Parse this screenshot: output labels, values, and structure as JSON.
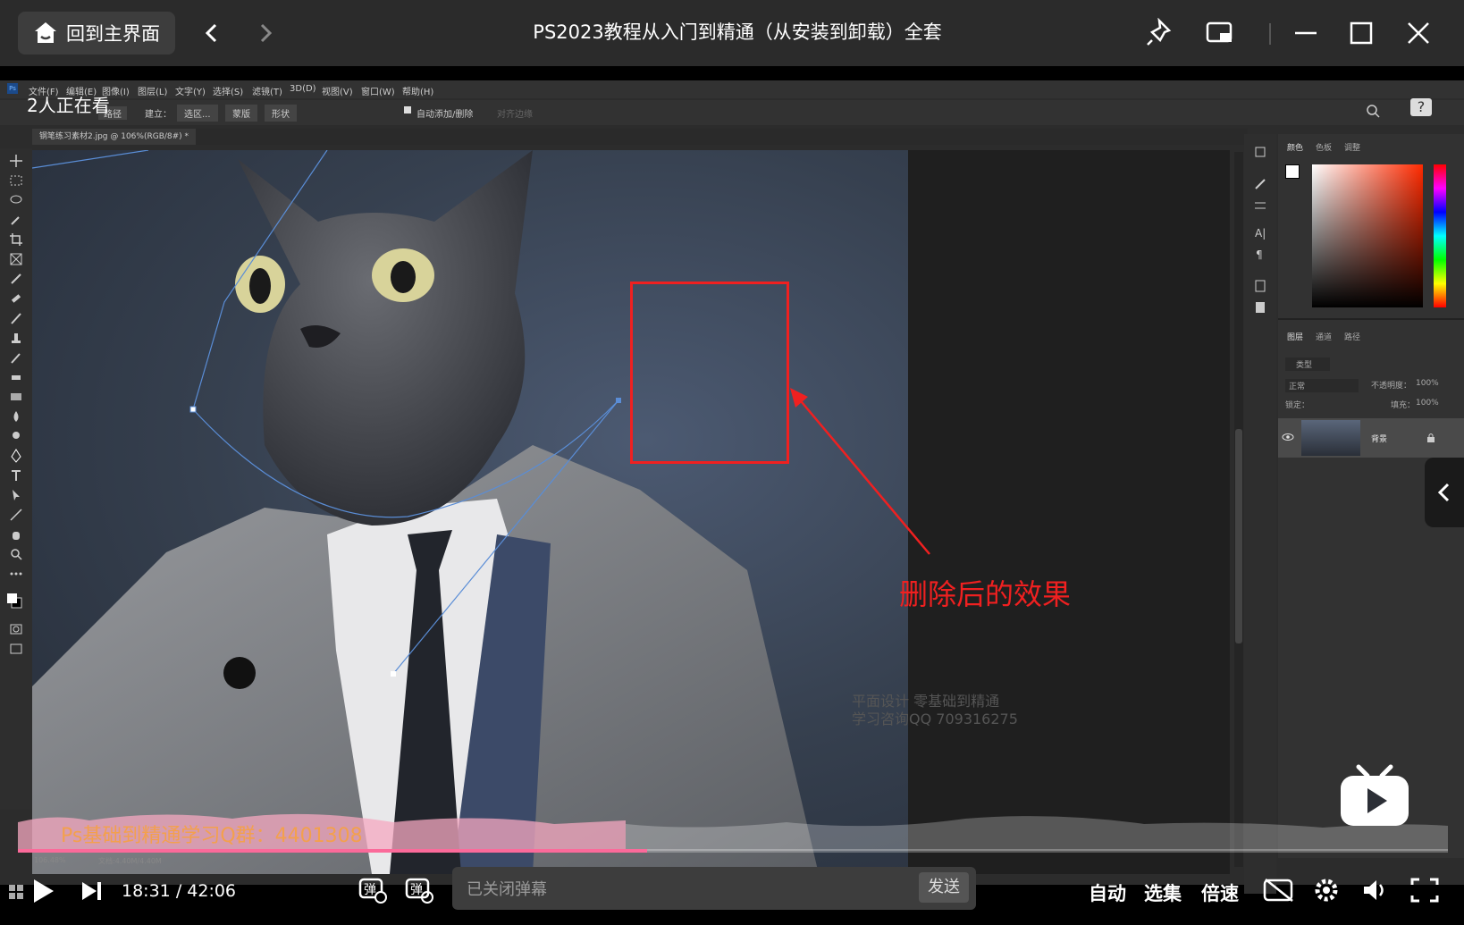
{
  "topbar": {
    "home_label": "回到主界面",
    "title": "PS2023教程从入门到精通（从安装到卸载）全套"
  },
  "ps": {
    "menus": [
      "文件(F)",
      "编辑(E)",
      "图像(I)",
      "图层(L)",
      "文字(Y)",
      "选择(S)",
      "滤镜(T)",
      "3D(D)",
      "视图(V)",
      "窗口(W)",
      "帮助(H)"
    ],
    "options": {
      "mode": "路径",
      "make_label": "建立：",
      "selection_btn": "选区...",
      "mask_btn": "蒙版",
      "shape_btn": "形状",
      "auto_add_delete": "自动添加/删除",
      "align_edges": "对齐边缘"
    },
    "doc_tab": "钢笔练习素材2.jpg @ 106%(RGB/8#) *",
    "status_zoom": "106.48%",
    "status_doc": "文档:4.40M/4.40M",
    "panels": {
      "color_tabs": [
        "颜色",
        "色板",
        "调整"
      ],
      "layer_tabs": [
        "图层",
        "通道",
        "路径"
      ],
      "layer_kind": "类型",
      "blend_mode": "正常",
      "opacity_label": "不透明度：",
      "opacity_value": "100%",
      "lock_label": "锁定：",
      "fill_label": "填充：",
      "fill_value": "100%",
      "layer_name": "背景"
    }
  },
  "overlay": {
    "watchers": "2人正在看",
    "annotation": "删除后的效果",
    "watermark_line1": "平面设计 零基础到精通",
    "watermark_line2": "学习咨询QQ 709316275",
    "qq_group": "Ps基础到精通学习Q群：4401308"
  },
  "player": {
    "current_time": "18:31",
    "separator": "/",
    "total_time": "42:06",
    "progress_fraction": 0.44,
    "danmu_placeholder": "已关闭弹幕",
    "send_label": "发送",
    "auto_label": "自动",
    "episodes_label": "选集",
    "speed_label": "倍速"
  },
  "colors": {
    "accent_red": "#f02020",
    "progress_pink": "#fb6a9a",
    "qq_orange": "#f3a04d"
  }
}
